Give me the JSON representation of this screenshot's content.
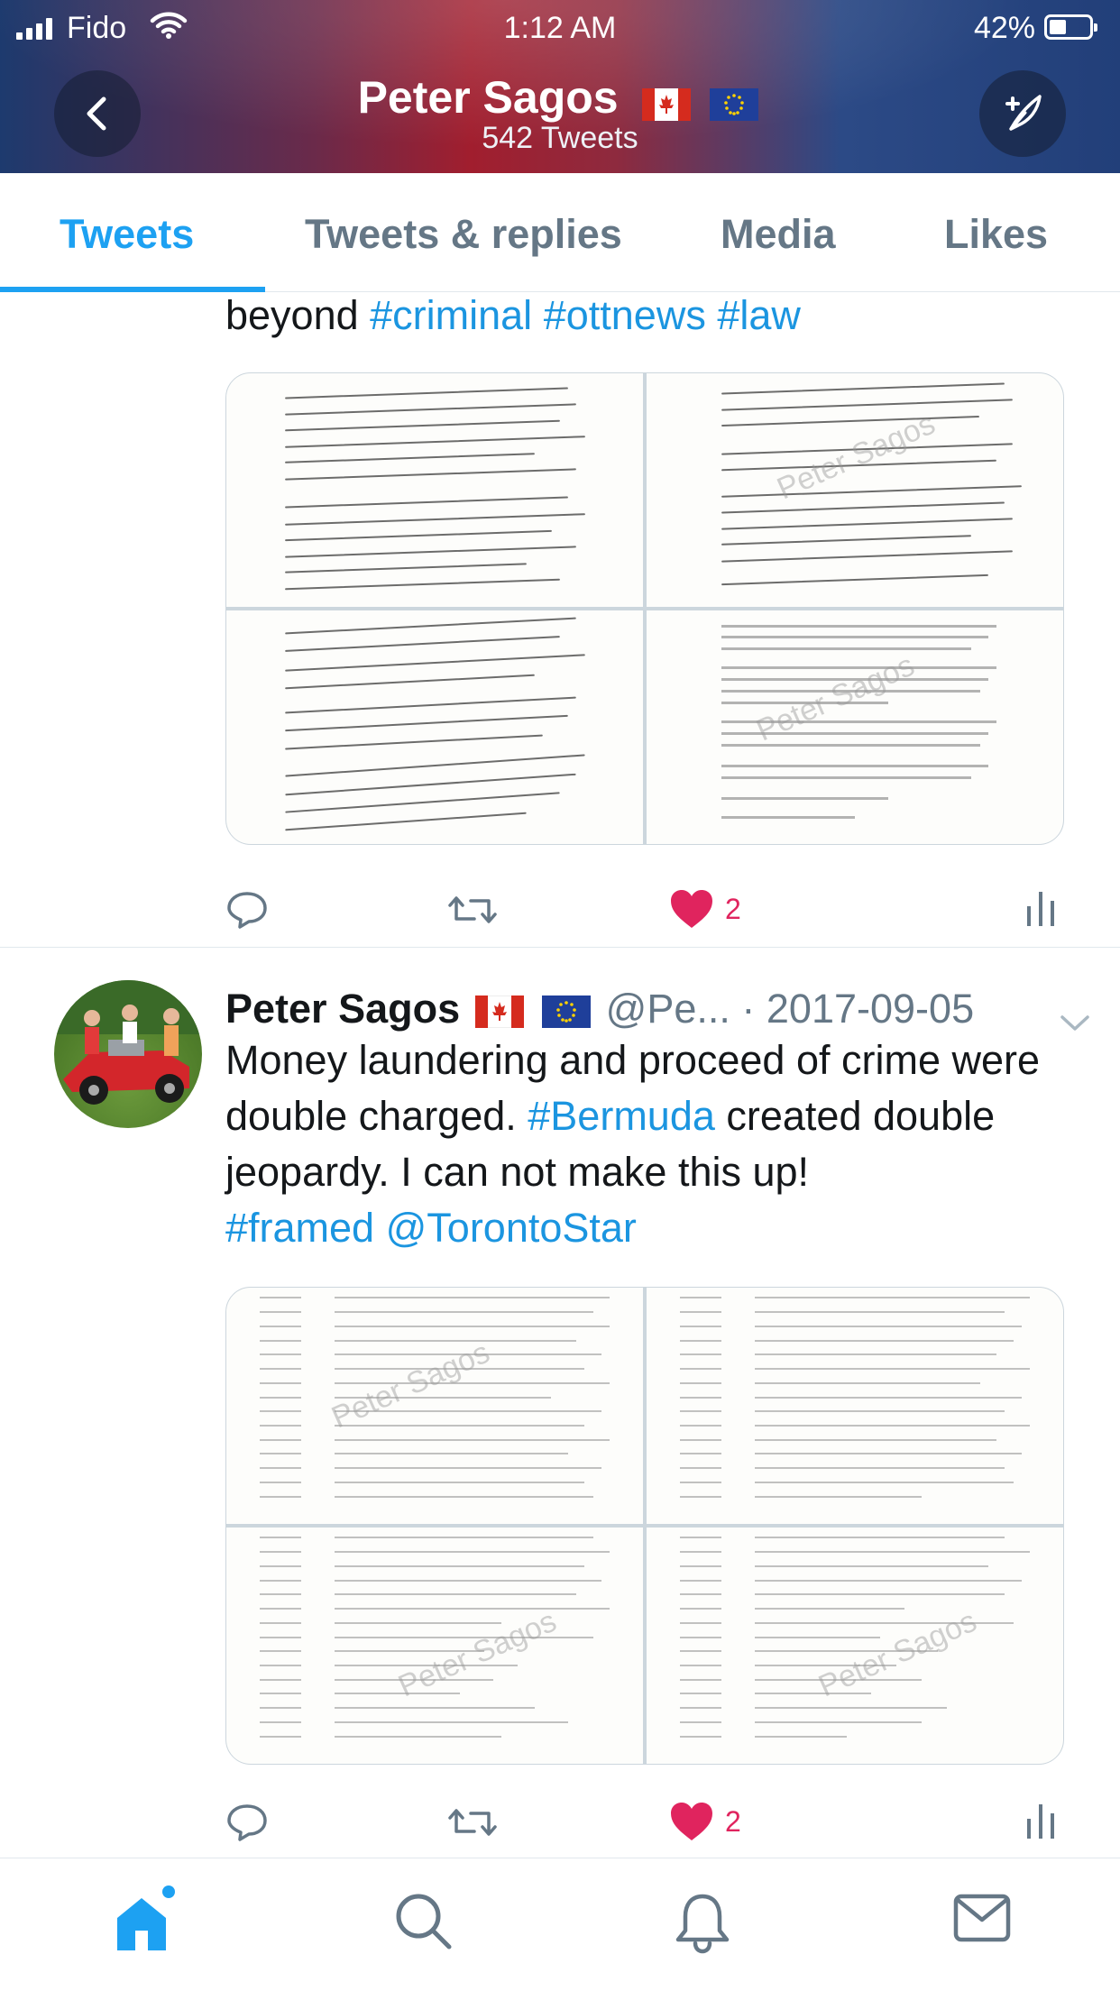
{
  "status_bar": {
    "carrier": "Fido",
    "time": "1:12 AM",
    "battery": "42%"
  },
  "header": {
    "name": "Peter Sagos",
    "flags": [
      "flag-canada",
      "flag-eu"
    ],
    "tweet_count": "542 Tweets",
    "back_icon": "chevron-left-icon",
    "compose_icon": "compose-tweet-icon"
  },
  "tabs": [
    {
      "label": "Tweets",
      "active": true
    },
    {
      "label": "Tweets & replies",
      "active": false
    },
    {
      "label": "Media",
      "active": false
    },
    {
      "label": "Likes",
      "active": false
    }
  ],
  "tweets": [
    {
      "text_prefix": "beyond ",
      "hashtags": [
        "#criminal",
        "#ottnews",
        "#law"
      ],
      "media_watermark": "Peter Sagos",
      "actions": {
        "reply": "",
        "retweet": "",
        "like_count": "2",
        "analytics": ""
      }
    },
    {
      "author": "Peter Sagos",
      "handle": "@Pe...",
      "date": "· 2017-09-05",
      "text_part1": "Money laundering and proceed of crime were double charged. ",
      "tag_bermuda": "#Bermuda",
      "text_part2": " created double jeopardy. I can not make this up!",
      "tag_framed": "#framed",
      "mention": "@TorontoStar",
      "media_watermark": "Peter Sagos",
      "actions": {
        "reply": "",
        "retweet": "",
        "like_count": "2",
        "analytics": ""
      }
    }
  ],
  "tabbar": {
    "items": [
      "home-icon",
      "search-icon",
      "notifications-icon",
      "messages-icon"
    ],
    "accent": "#1da1f2"
  },
  "colors": {
    "link": "#1b95e0",
    "like": "#e0245e",
    "muted": "#657786"
  }
}
